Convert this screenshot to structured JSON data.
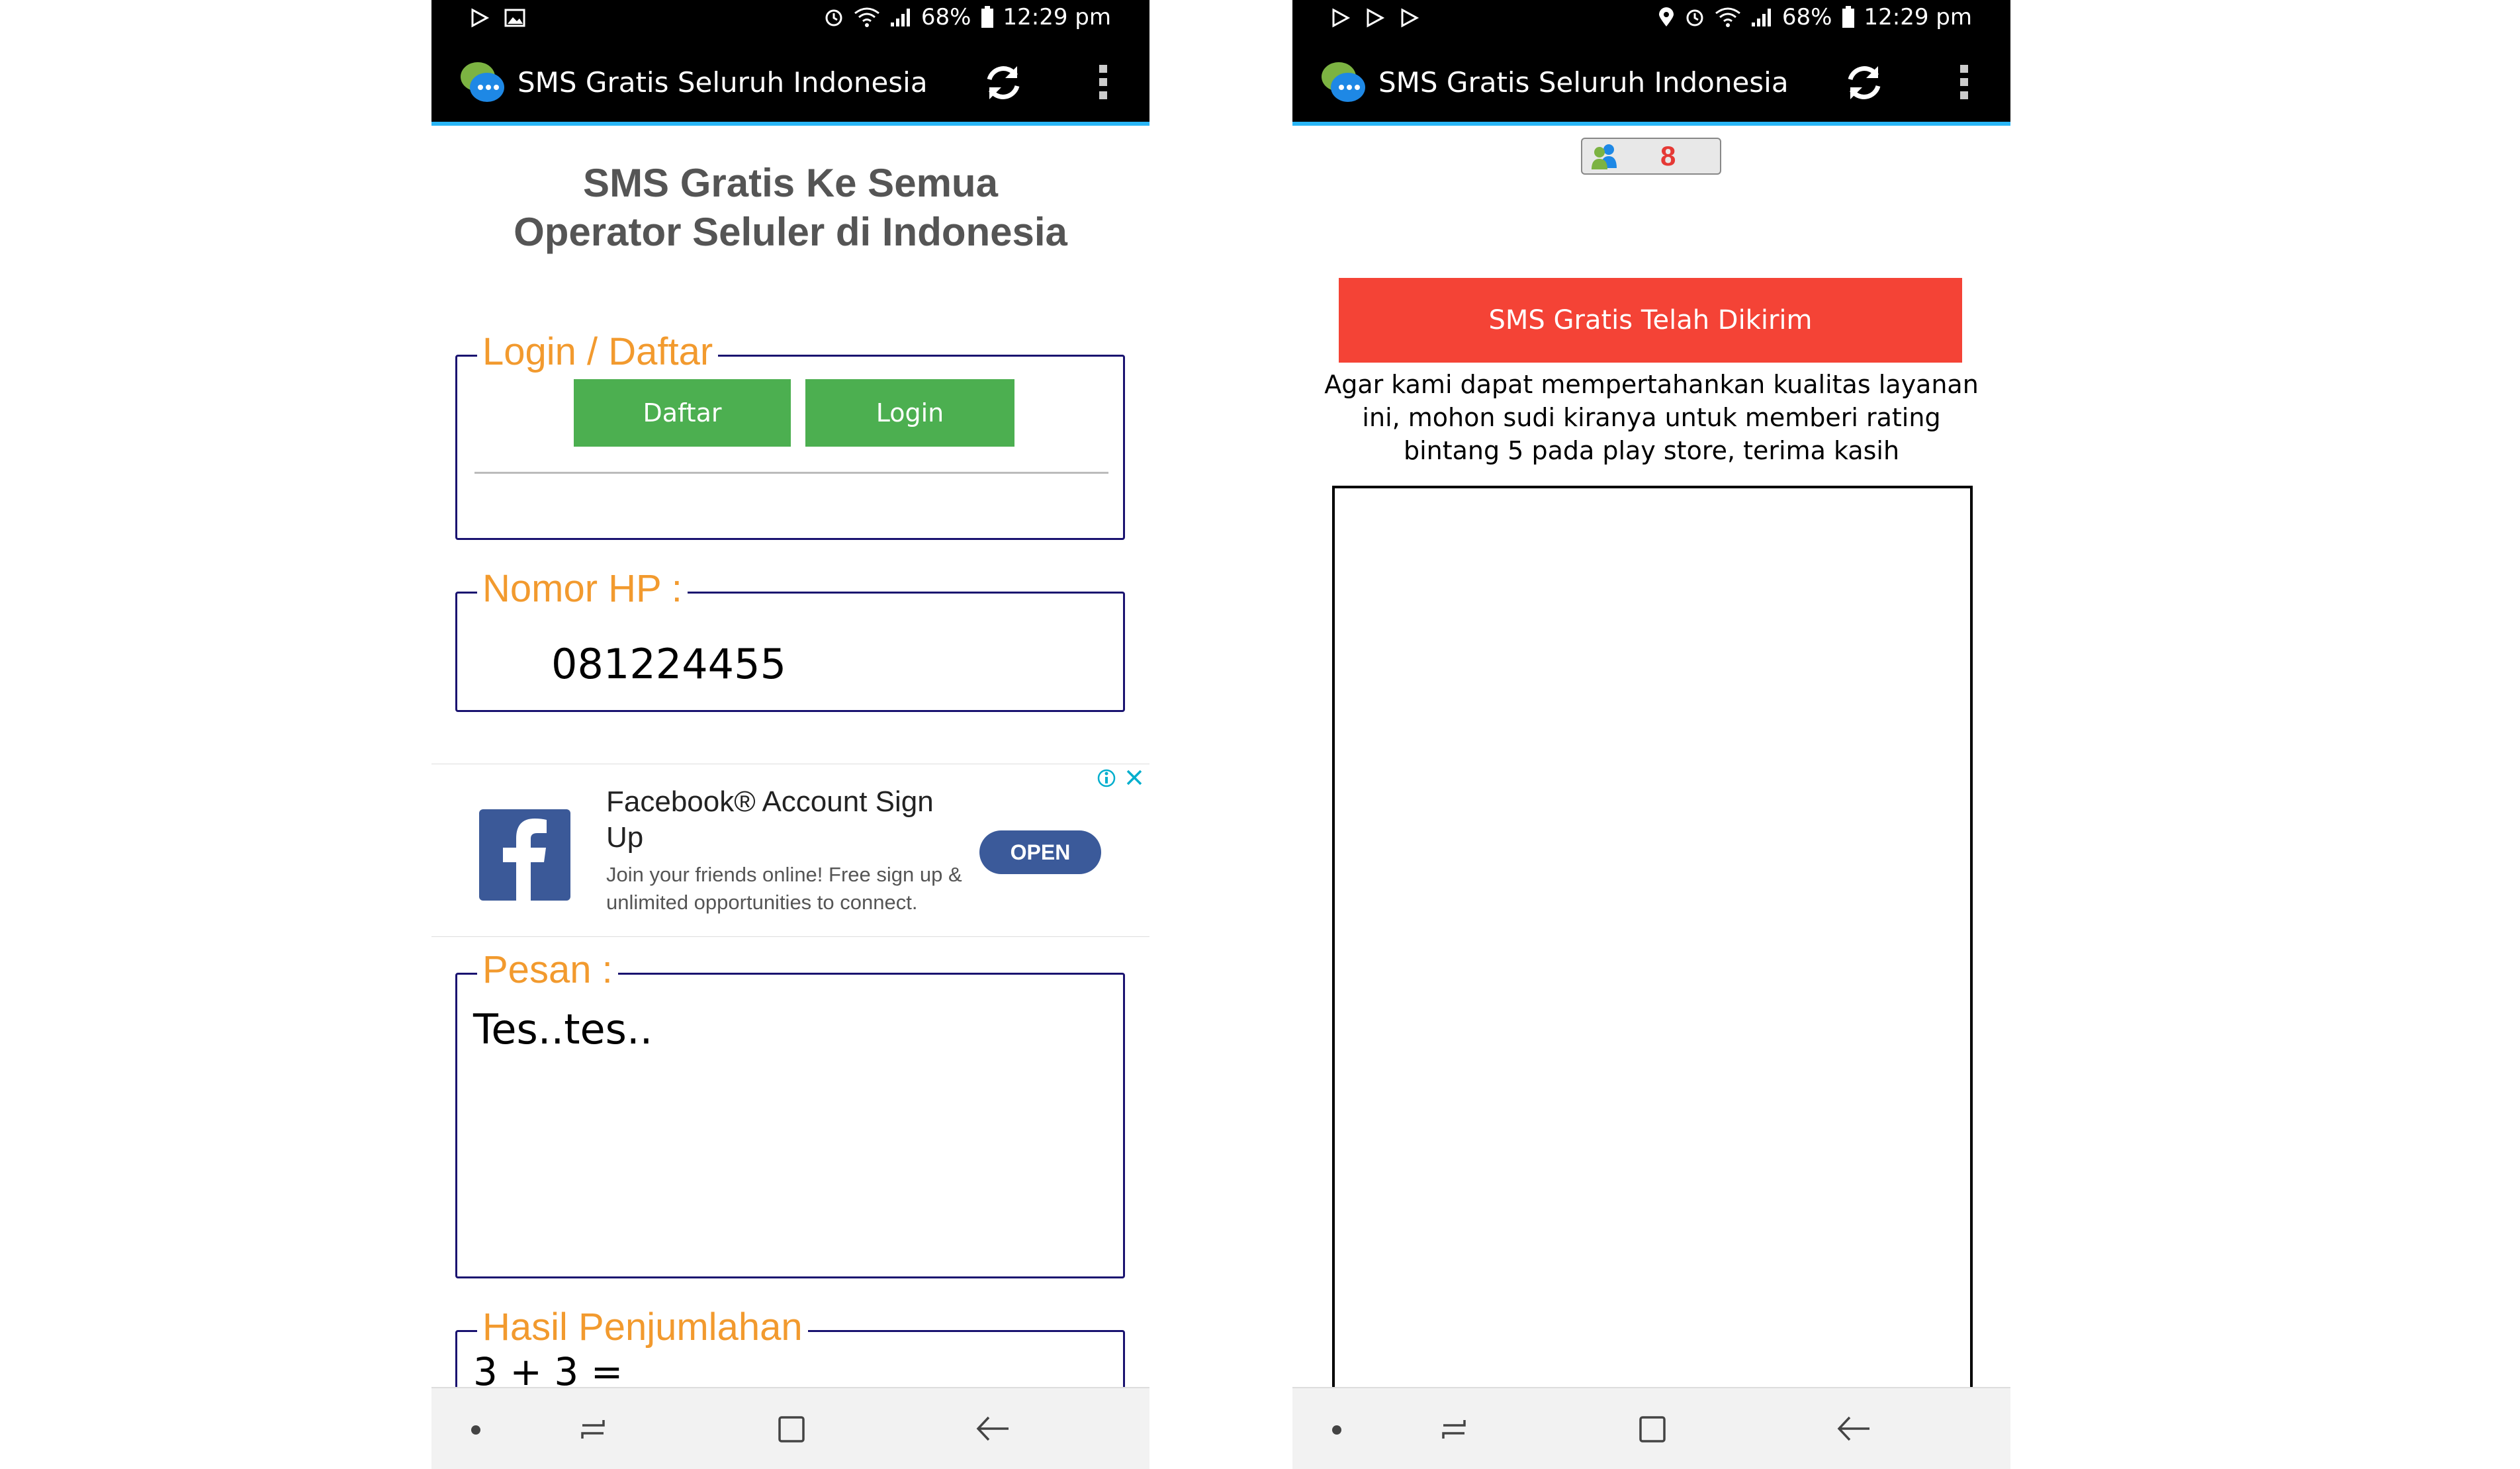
{
  "left_screen": {
    "status": {
      "battery": "68%",
      "time": "12:29 pm"
    },
    "appbar": {
      "title": "SMS Gratis Seluruh Indonesia"
    },
    "heading": "SMS Gratis Ke Semua Operator Seluler di Indonesia",
    "login_section": {
      "legend": "Login / Daftar",
      "daftar_label": "Daftar",
      "login_label": "Login"
    },
    "phone_section": {
      "legend": "Nomor HP :",
      "value": "081224455"
    },
    "ad": {
      "title": "Facebook® Account Sign Up",
      "description": "Join your friends online! Free sign up & unlimited opportunities to connect.",
      "open_label": "OPEN"
    },
    "message_section": {
      "legend": "Pesan :",
      "value": "Tes..tes.."
    },
    "sum_section": {
      "legend": "Hasil Penjumlahan",
      "question": "3 + 3 ="
    }
  },
  "right_screen": {
    "status": {
      "battery": "68%",
      "time": "12:29 pm"
    },
    "appbar": {
      "title": "SMS Gratis Seluruh Indonesia"
    },
    "counter": "8",
    "banner": "SMS Gratis Telah Dikirim",
    "rating_message": "Agar kami dapat mempertahankan kualitas layanan ini, mohon sudi kiranya untuk memberi rating bintang 5 pada play store, terima kasih"
  },
  "icons": {
    "status_left": [
      "play-store-icon",
      "image-icon"
    ],
    "status_right": [
      "alarm-icon",
      "wifi-icon",
      "signal-icon",
      "battery-icon"
    ],
    "appbar": [
      "chat-bubble-logo-icon",
      "refresh-icon",
      "more-vert-icon"
    ],
    "navbar": [
      "nav-dot-icon",
      "recent-apps-icon",
      "home-icon",
      "back-icon"
    ]
  },
  "colors": {
    "accent_orange": "#f29a2e",
    "button_green": "#4caf50",
    "banner_red": "#f44336",
    "ad_open_blue": "#3b5a9a",
    "fieldset_border": "#1a1370",
    "appbar_underline": "#29b6f6"
  }
}
